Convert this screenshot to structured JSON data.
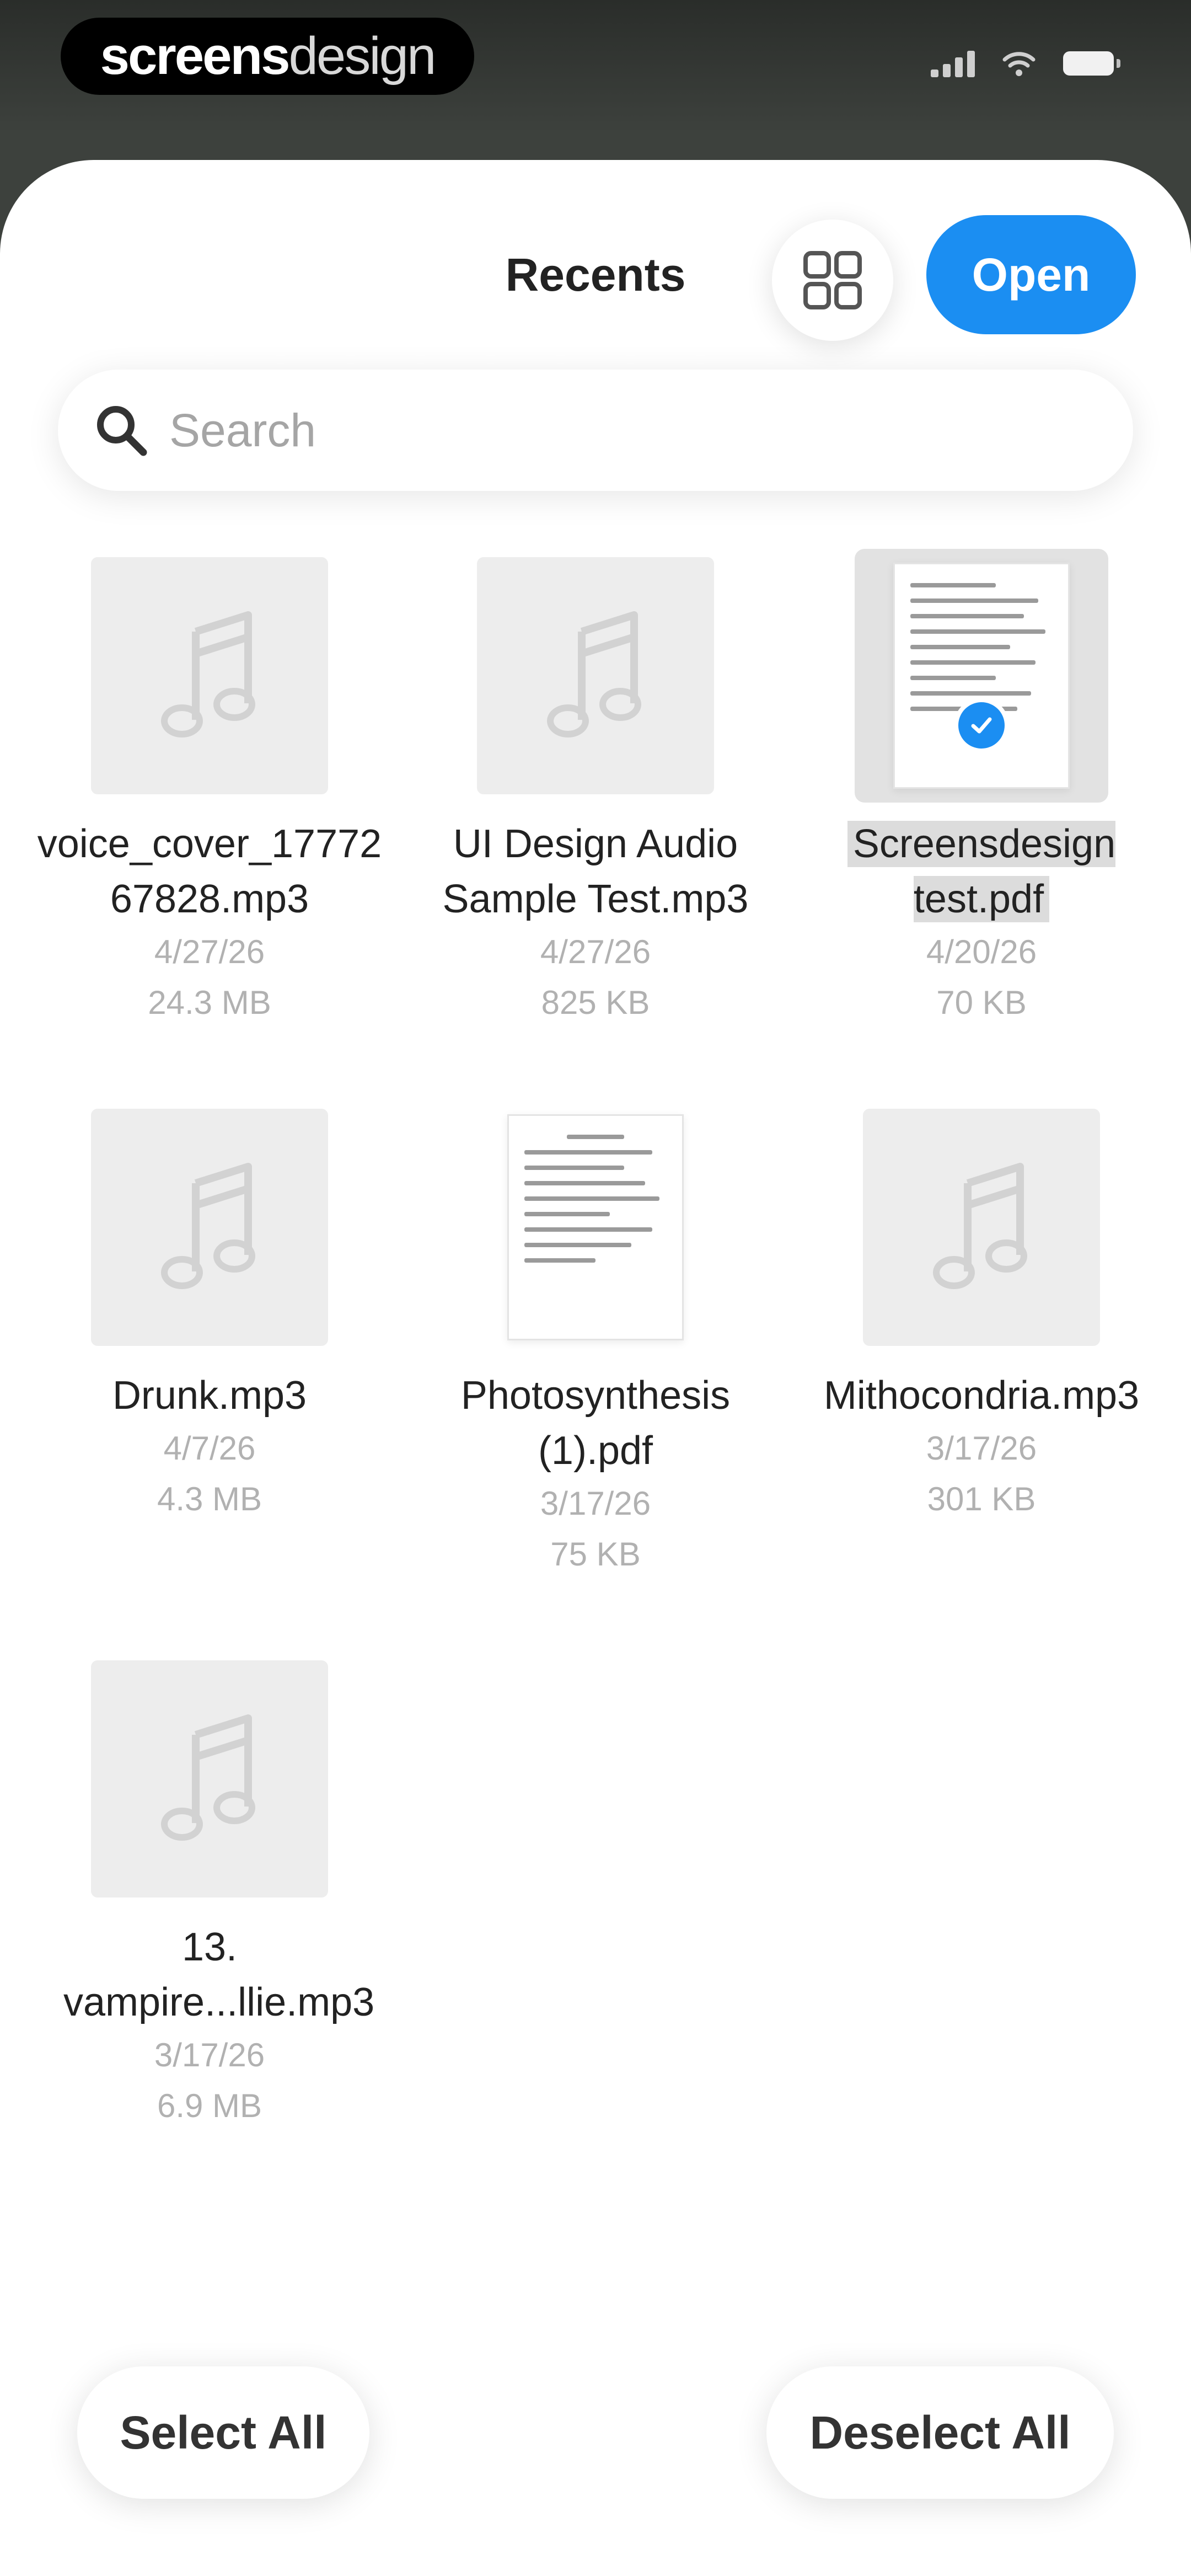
{
  "status_bar": {
    "brand_bold": "screens",
    "brand_light": "design"
  },
  "sheet": {
    "title": "Recents",
    "open_label": "Open",
    "search_placeholder": "Search"
  },
  "files": [
    {
      "name": "voice_cover_1777267828.mp3",
      "date": "4/27/26",
      "size": "24.3 MB",
      "type": "audio",
      "selected": false
    },
    {
      "name": "UI Design Audio Sample Test.mp3",
      "date": "4/27/26",
      "size": "825 KB",
      "type": "audio",
      "selected": false
    },
    {
      "name": "Screensdesign test.pdf",
      "date": "4/20/26",
      "size": "70 KB",
      "type": "pdf",
      "selected": true
    },
    {
      "name": "Drunk.mp3",
      "date": "4/7/26",
      "size": "4.3 MB",
      "type": "audio",
      "selected": false
    },
    {
      "name": "Photosynthesis (1).pdf",
      "date": "3/17/26",
      "size": "75 KB",
      "type": "pdf",
      "selected": false
    },
    {
      "name": "Mithocondria.mp3",
      "date": "3/17/26",
      "size": "301 KB",
      "type": "audio",
      "selected": false
    },
    {
      "name": "13. vampire...llie.mp3",
      "date": "3/17/26",
      "size": "6.9 MB",
      "type": "audio",
      "selected": false
    }
  ],
  "actions": {
    "select_all": "Select All",
    "deselect_all": "Deselect All"
  },
  "colors": {
    "accent": "#1b8ef2",
    "thumb_bg": "#ededed",
    "meta_text": "#b1b1b1"
  }
}
